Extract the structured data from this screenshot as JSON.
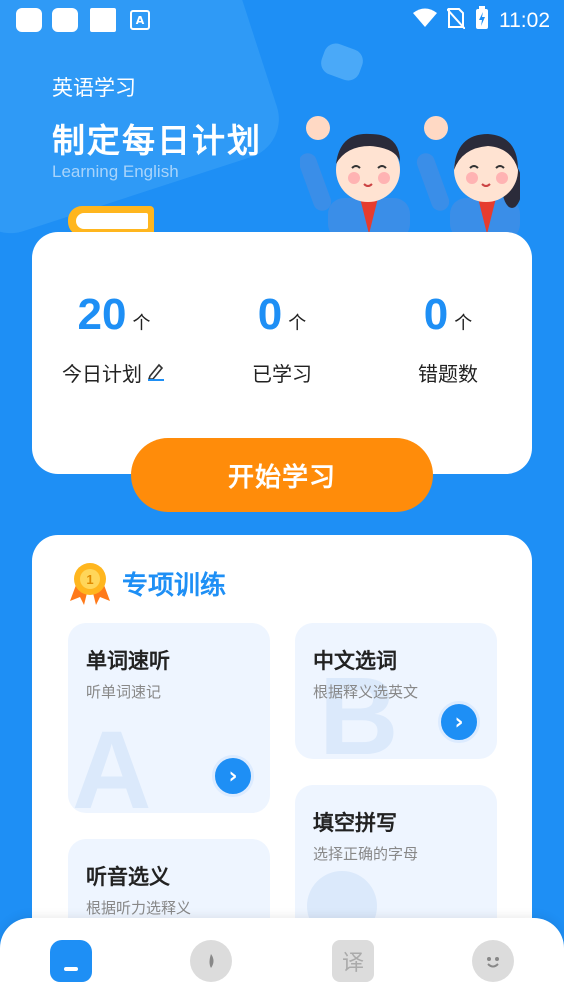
{
  "status_bar": {
    "time": "11:02",
    "notification_badge": "A"
  },
  "header": {
    "subtitle": "英语学习",
    "title": "制定每日计划",
    "english": "Learning English"
  },
  "stats": [
    {
      "value": "20",
      "unit": "个",
      "label": "今日计划"
    },
    {
      "value": "0",
      "unit": "个",
      "label": "已学习"
    },
    {
      "value": "0",
      "unit": "个",
      "label": "错题数"
    }
  ],
  "start_button": "开始学习",
  "training": {
    "title": "专项训练",
    "tiles": [
      {
        "title": "单词速听",
        "desc": "听单词速记",
        "letter": "A"
      },
      {
        "title": "中文选词",
        "desc": "根据释义选英文",
        "letter": "B"
      },
      {
        "title": "填空拼写",
        "desc": "选择正确的字母"
      },
      {
        "title": "听音选义",
        "desc": "根据听力选释义"
      }
    ]
  },
  "nav": {
    "translate_label": "译"
  },
  "colors": {
    "primary": "#1e8ff5",
    "accent": "#ff8c0a",
    "tile_bg": "#eef5ff"
  }
}
